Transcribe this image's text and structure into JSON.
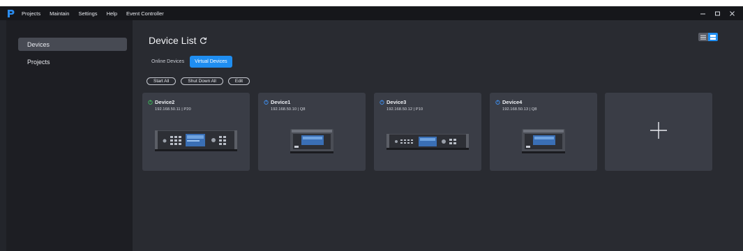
{
  "menubar": {
    "items": [
      "Projects",
      "Maintain",
      "Settings",
      "Help",
      "Event Controller"
    ]
  },
  "sidebar": {
    "items": [
      {
        "label": "Devices",
        "active": true
      },
      {
        "label": "Projects",
        "active": false
      }
    ]
  },
  "main": {
    "title": "Device List",
    "tabs": [
      {
        "label": "Online Devices",
        "active": false
      },
      {
        "label": "Virtual Devices",
        "active": true
      }
    ],
    "actions": [
      "Start All",
      "Shut Down All",
      "Edit"
    ],
    "devices": [
      {
        "name": "Device2",
        "ip": "192.168.50.11",
        "model": "P20",
        "sub": "192.168.50.11  |  P20",
        "status": "online",
        "status_color": "#3dbb5a"
      },
      {
        "name": "Device1",
        "ip": "192.168.50.10",
        "model": "Q8",
        "sub": "192.168.50.10  |  Q8",
        "status": "offline",
        "status_color": "#3f8ff0"
      },
      {
        "name": "Device3",
        "ip": "192.168.50.12",
        "model": "P10",
        "sub": "192.168.50.12  |  P10",
        "status": "offline",
        "status_color": "#3f8ff0"
      },
      {
        "name": "Device4",
        "ip": "192.168.50.13",
        "model": "Q8",
        "sub": "192.168.50.13  |  Q8",
        "status": "offline",
        "status_color": "#3f8ff0"
      }
    ]
  },
  "colors": {
    "accent": "#1f8ef1",
    "card_bg": "#3a3d46",
    "content_bg": "#292b31",
    "sidebar_bg": "#1d1e23"
  }
}
